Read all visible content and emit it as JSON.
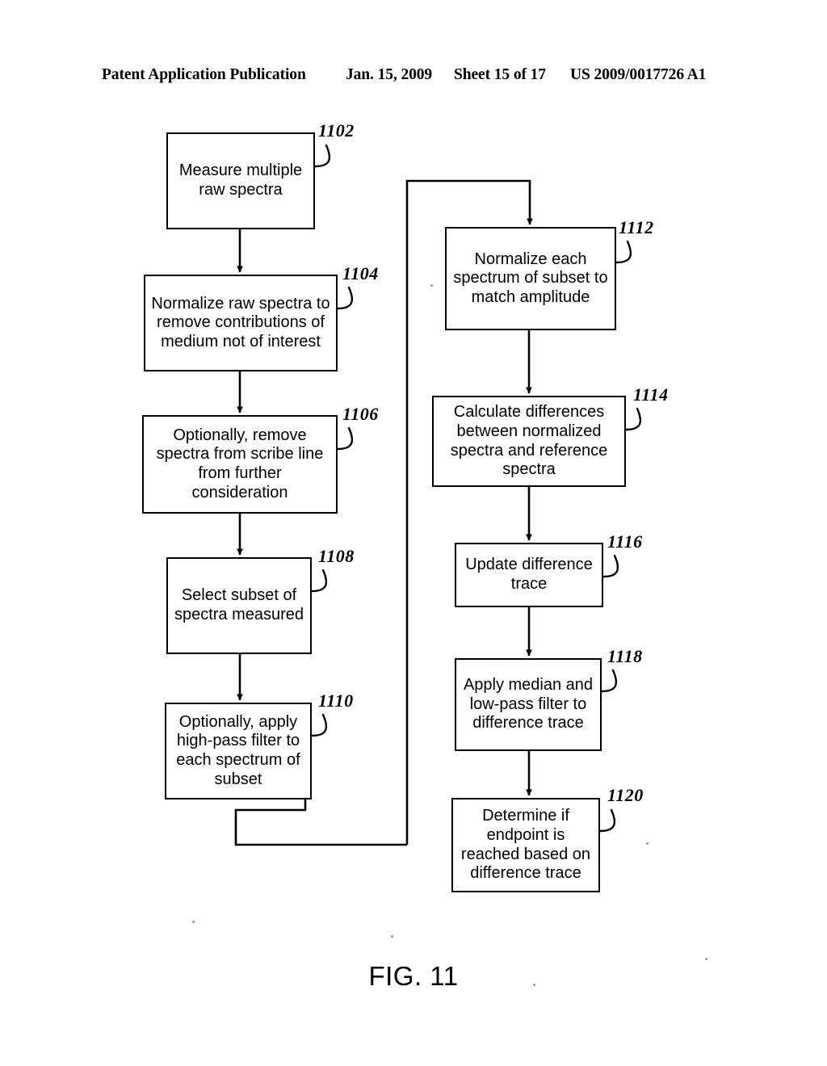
{
  "header": {
    "publication": "Patent Application Publication",
    "date": "Jan. 15, 2009",
    "sheet": "Sheet 15 of 17",
    "number": "US 2009/0017726 A1"
  },
  "figure": {
    "caption": "FIG. 11",
    "line_color": "#000000"
  },
  "flowchart": {
    "nodes": [
      {
        "ref": "1102",
        "text": "Measure multiple\nraw spectra"
      },
      {
        "ref": "1104",
        "text": "Normalize raw spectra to\nremove contributions of\nmedium not of interest"
      },
      {
        "ref": "1106",
        "text": "Optionally, remove\nspectra from scribe line\nfrom further consideration"
      },
      {
        "ref": "1108",
        "text": "Select subset of\nspectra measured"
      },
      {
        "ref": "1110",
        "text": "Optionally, apply\nhigh-pass filter to\neach spectrum of\nsubset"
      },
      {
        "ref": "1112",
        "text": "Normalize each\nspectrum of subset  to\nmatch amplitude"
      },
      {
        "ref": "1114",
        "text": "Calculate differences\nbetween normalized\nspectra and reference\nspectra"
      },
      {
        "ref": "1116",
        "text": "Update difference\ntrace"
      },
      {
        "ref": "1118",
        "text": "Apply median and\nlow-pass filter to\ndifference trace"
      },
      {
        "ref": "1120",
        "text": "Determine if\nendpoint is\nreached based on\ndifference trace"
      }
    ]
  }
}
